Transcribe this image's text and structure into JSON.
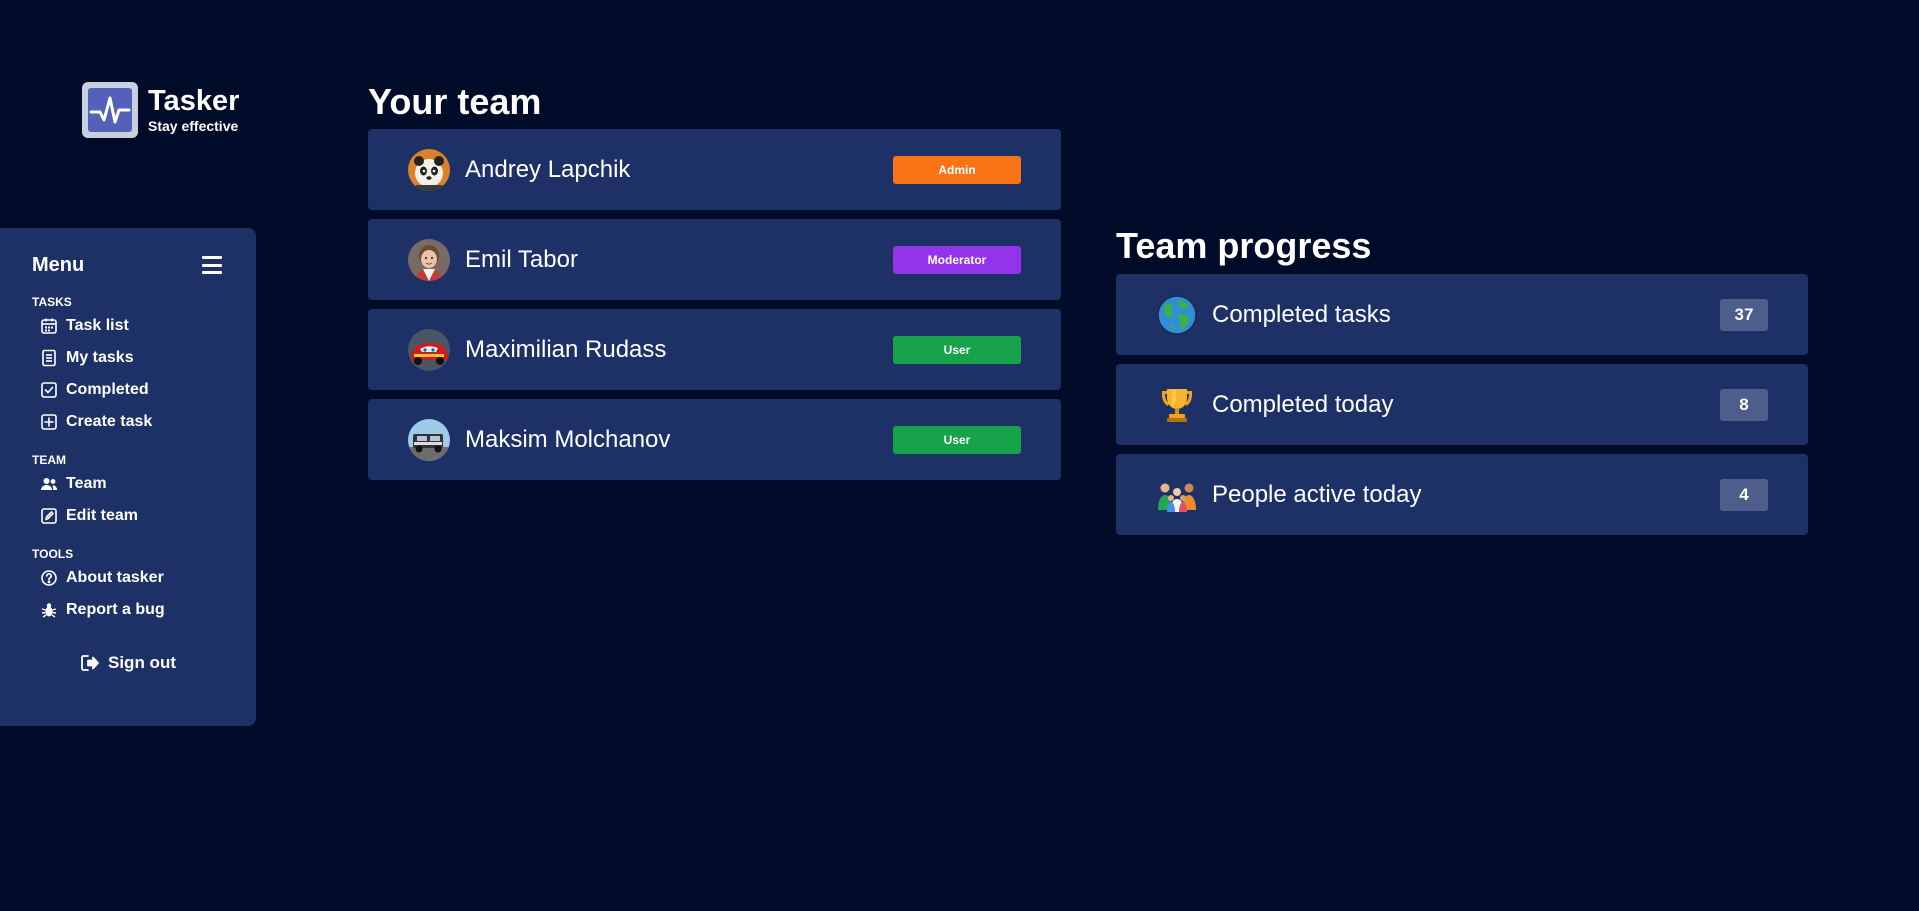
{
  "app": {
    "name": "Tasker",
    "tagline": "Stay effective",
    "logo_icon": "pulse-monitor-icon"
  },
  "sidebar": {
    "title": "Menu",
    "sections": [
      {
        "title": "TASKS",
        "items": [
          {
            "label": "Task list",
            "icon": "calendar-icon"
          },
          {
            "label": "My tasks",
            "icon": "document-icon"
          },
          {
            "label": "Completed",
            "icon": "checkbox-icon"
          },
          {
            "label": "Create task",
            "icon": "plus-square-icon"
          }
        ]
      },
      {
        "title": "TEAM",
        "items": [
          {
            "label": "Team",
            "icon": "people-icon"
          },
          {
            "label": "Edit team",
            "icon": "edit-icon"
          }
        ]
      },
      {
        "title": "TOOLS",
        "items": [
          {
            "label": "About tasker",
            "icon": "question-circle-icon"
          },
          {
            "label": "Report a bug",
            "icon": "bug-icon"
          }
        ]
      }
    ],
    "sign_out_label": "Sign out"
  },
  "team": {
    "title": "Your team",
    "members": [
      {
        "name": "Andrey Lapchik",
        "role": "Admin",
        "role_color": "#f97316",
        "avatar": "panda-avatar"
      },
      {
        "name": "Emil Tabor",
        "role": "Moderator",
        "role_color": "#9333ea",
        "avatar": "child-avatar"
      },
      {
        "name": "Maximilian Rudass",
        "role": "User",
        "role_color": "#16a34a",
        "avatar": "red-car-avatar"
      },
      {
        "name": "Maksim Molchanov",
        "role": "User",
        "role_color": "#16a34a",
        "avatar": "truck-avatar"
      }
    ]
  },
  "progress": {
    "title": "Team progress",
    "stats": [
      {
        "label": "Completed tasks",
        "value": "37",
        "icon": "globe-icon"
      },
      {
        "label": "Completed today",
        "value": "8",
        "icon": "trophy-icon"
      },
      {
        "label": "People active today",
        "value": "4",
        "icon": "family-icon"
      }
    ]
  },
  "colors": {
    "background": "#000b29",
    "card": "#1e3166",
    "count_badge": "#4d5e8c"
  }
}
